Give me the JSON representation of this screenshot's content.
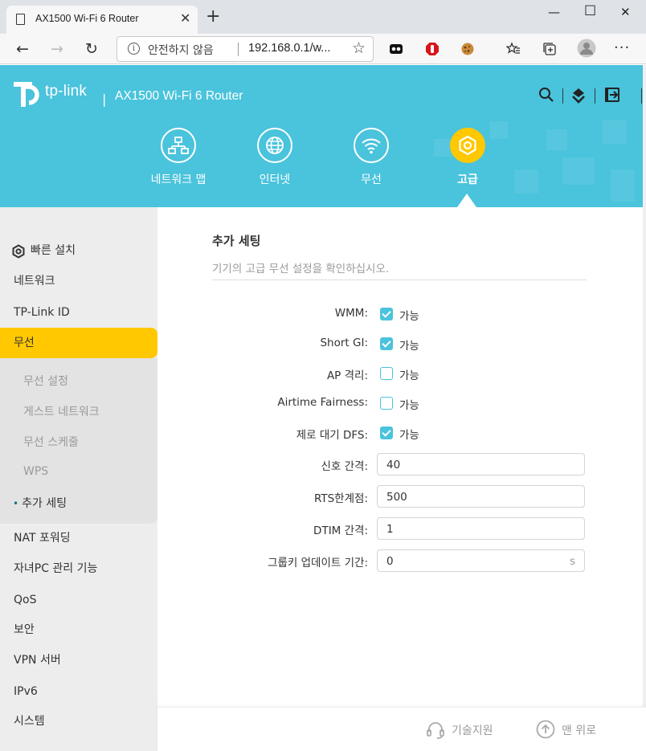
{
  "browser": {
    "tab_title": "AX1500 Wi-Fi 6 Router",
    "security_label": "안전하지 않음",
    "url": "192.168.0.1/w..."
  },
  "header": {
    "brand": "tp-link",
    "model": "AX1500 Wi-Fi 6 Router",
    "nav": [
      {
        "label": "네트워크 맵",
        "icon": "network-map-icon"
      },
      {
        "label": "인터넷",
        "icon": "globe-icon"
      },
      {
        "label": "무선",
        "icon": "wifi-icon"
      },
      {
        "label": "고급",
        "icon": "gear-icon",
        "active": true
      }
    ],
    "accent_color": "#4ac3dc",
    "active_color": "#ffc800"
  },
  "sidebar": {
    "items": [
      {
        "label": "빠른 설치",
        "icon": "gear-icon"
      },
      {
        "label": "네트워크"
      },
      {
        "label": "TP-Link ID"
      },
      {
        "label": "무선",
        "active": true
      },
      {
        "label": "NAT 포워딩"
      },
      {
        "label": "자녀PC 관리 기능"
      },
      {
        "label": "QoS"
      },
      {
        "label": "보안"
      },
      {
        "label": "VPN 서버"
      },
      {
        "label": "IPv6"
      },
      {
        "label": "시스템"
      }
    ],
    "sub_items": [
      {
        "label": "무선 설정"
      },
      {
        "label": "게스트 네트워크"
      },
      {
        "label": "무선 스케줄"
      },
      {
        "label": "WPS"
      },
      {
        "label": "추가 세팅",
        "active": true,
        "bullet": "•"
      }
    ]
  },
  "main": {
    "title": "추가 세팅",
    "subtitle": "기기의 고급 무선 설정을 확인하십시오.",
    "checkbox_rows": [
      {
        "label": "WMM:",
        "checked": true,
        "text": "가능"
      },
      {
        "label": "Short GI:",
        "checked": true,
        "text": "가능"
      },
      {
        "label": "AP 격리:",
        "checked": false,
        "text": "가능"
      },
      {
        "label": "Airtime Fairness:",
        "checked": false,
        "text": "가능"
      },
      {
        "label": "제로 대기 DFS:",
        "checked": true,
        "text": "가능"
      }
    ],
    "field_rows": [
      {
        "label": "신호 간격:",
        "value": "40",
        "unit": ""
      },
      {
        "label": "RTS한계점:",
        "value": "500",
        "unit": ""
      },
      {
        "label": "DTIM 간격:",
        "value": "1",
        "unit": ""
      },
      {
        "label": "그룹키 업데이트 기간:",
        "value": "0",
        "unit": "s"
      }
    ]
  },
  "footer": {
    "support": "기술지원",
    "top": "맨 위로"
  }
}
